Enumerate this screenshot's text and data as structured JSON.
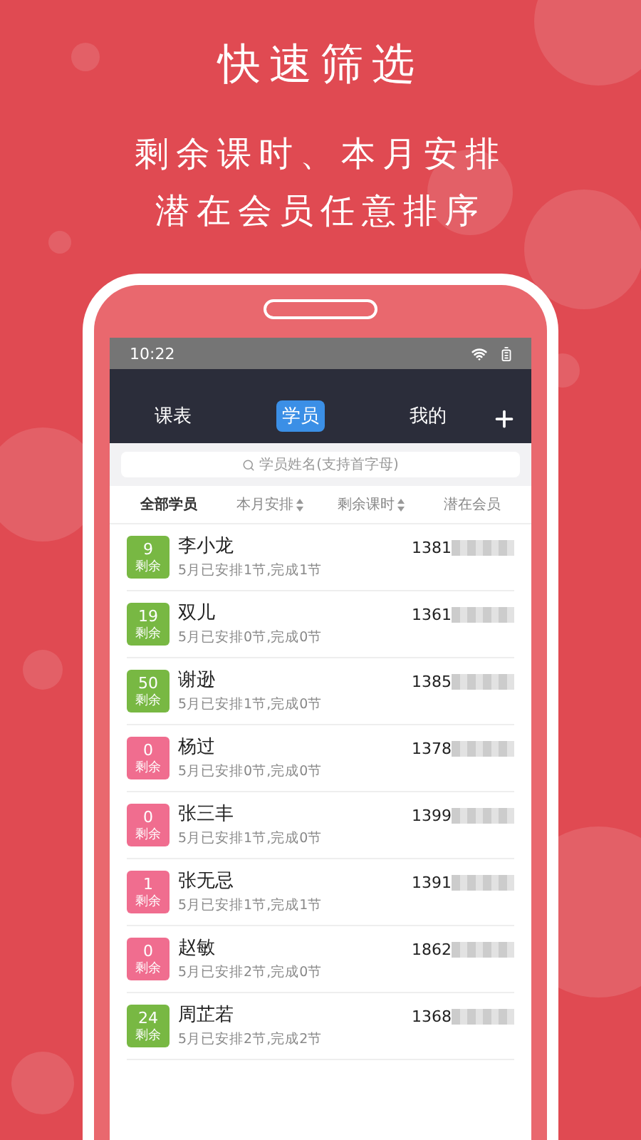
{
  "headline": "快速筛选",
  "subtitle_lines": [
    "剩余课时、本月安排",
    "潜在会员任意排序"
  ],
  "status_bar": {
    "time": "10:22"
  },
  "tabs": [
    {
      "label": "课表",
      "selected": false
    },
    {
      "label": "学员",
      "selected": true
    },
    {
      "label": "我的",
      "selected": false
    }
  ],
  "search": {
    "placeholder": "学员姓名(支持首字母)"
  },
  "filters": [
    {
      "label": "全部学员",
      "selected": true,
      "sortable": false
    },
    {
      "label": "本月安排",
      "selected": false,
      "sortable": true
    },
    {
      "label": "剩余课时",
      "selected": false,
      "sortable": true
    },
    {
      "label": "潜在会员",
      "selected": false,
      "sortable": false
    }
  ],
  "students": [
    {
      "count": "9",
      "badge_label": "剩余",
      "color": "#78b843",
      "name": "李小龙",
      "schedule": "5月已安排1节,完成1节",
      "phone": "1381"
    },
    {
      "count": "19",
      "badge_label": "剩余",
      "color": "#78b843",
      "name": "双儿",
      "schedule": "5月已安排0节,完成0节",
      "phone": "1361"
    },
    {
      "count": "50",
      "badge_label": "剩余",
      "color": "#78b843",
      "name": "谢逊",
      "schedule": "5月已安排1节,完成0节",
      "phone": "1385"
    },
    {
      "count": "0",
      "badge_label": "剩余",
      "color": "#f06d8f",
      "name": "杨过",
      "schedule": "5月已安排0节,完成0节",
      "phone": "1378"
    },
    {
      "count": "0",
      "badge_label": "剩余",
      "color": "#f06d8f",
      "name": "张三丰",
      "schedule": "5月已安排1节,完成0节",
      "phone": "1399"
    },
    {
      "count": "1",
      "badge_label": "剩余",
      "color": "#f06d8f",
      "name": "张无忌",
      "schedule": "5月已安排1节,完成1节",
      "phone": "1391"
    },
    {
      "count": "0",
      "badge_label": "剩余",
      "color": "#f06d8f",
      "name": "赵敏",
      "schedule": "5月已安排2节,完成0节",
      "phone": "1862"
    },
    {
      "count": "24",
      "badge_label": "剩余",
      "color": "#78b843",
      "name": "周芷若",
      "schedule": "5月已安排2节,完成2节",
      "phone": "1368"
    }
  ]
}
